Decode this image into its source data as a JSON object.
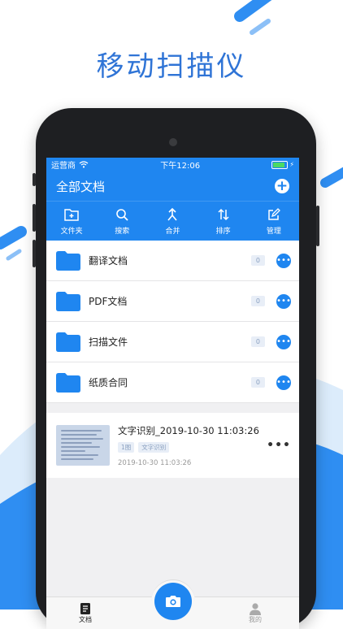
{
  "headline": "移动扫描仪",
  "status": {
    "carrier": "运营商",
    "time": "下午12:06"
  },
  "nav": {
    "title": "全部文档"
  },
  "toolbar": [
    {
      "label": "文件夹",
      "icon": "folder-add-icon"
    },
    {
      "label": "搜索",
      "icon": "search-icon"
    },
    {
      "label": "合并",
      "icon": "merge-icon"
    },
    {
      "label": "排序",
      "icon": "sort-icon"
    },
    {
      "label": "管理",
      "icon": "edit-icon"
    }
  ],
  "folders": [
    {
      "name": "翻译文档",
      "count": "0"
    },
    {
      "name": "PDF文档",
      "count": "0"
    },
    {
      "name": "扫描文件",
      "count": "0"
    },
    {
      "name": "纸质合同",
      "count": "0"
    }
  ],
  "document": {
    "title": "文字识别_2019-10-30 11:03:26",
    "pages": "1图",
    "tag": "文字识别",
    "date": "2019-10-30 11:03:26"
  },
  "tabs": {
    "docs": "文档",
    "mine": "我的"
  },
  "colors": {
    "accent": "#1f86f0",
    "headline": "#2f74d6"
  }
}
